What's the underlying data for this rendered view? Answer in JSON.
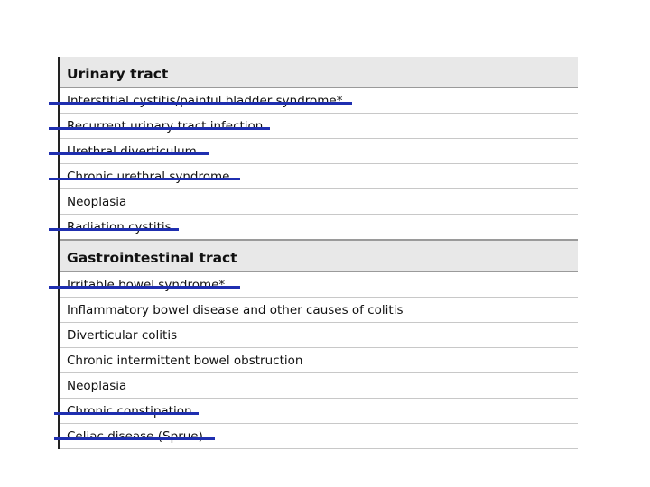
{
  "sections": [
    {
      "title": "Urinary tract",
      "items": [
        {
          "label": "Interstitial cystitis/painful bladder syndrome*",
          "struck": true
        },
        {
          "label": "Recurrent urinary tract infection",
          "struck": true
        },
        {
          "label": "Urethral diverticulum",
          "struck": true
        },
        {
          "label": "Chronic urethral syndrome",
          "struck": true
        },
        {
          "label": "Neoplasia",
          "struck": false
        },
        {
          "label": "Radiation cystitis",
          "struck": true
        }
      ]
    },
    {
      "title": "Gastrointestinal tract",
      "items": [
        {
          "label": "Irritable bowel syndrome*",
          "struck": true
        },
        {
          "label": "Inflammatory bowel disease and other causes of colitis",
          "struck": false
        },
        {
          "label": "Diverticular colitis",
          "struck": false
        },
        {
          "label": "Chronic intermittent bowel obstruction",
          "struck": false
        },
        {
          "label": "Neoplasia",
          "struck": false
        },
        {
          "label": "Chronic constipation",
          "struck": true
        },
        {
          "label": "Celiac disease (Sprue)",
          "struck": true
        }
      ]
    }
  ],
  "colors": {
    "strike": "#1f2fb0",
    "header_bg": "#e8e8e8"
  }
}
